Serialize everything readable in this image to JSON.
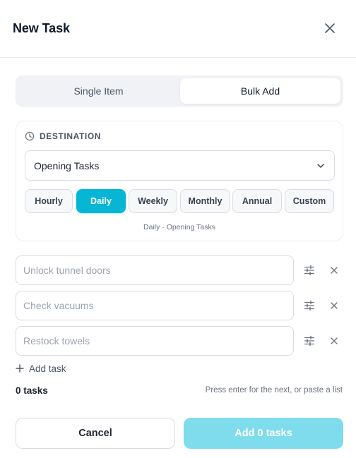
{
  "dialog": {
    "title": "New Task"
  },
  "mode_tabs": [
    {
      "label": "Single Item",
      "selected": false
    },
    {
      "label": "Bulk Add",
      "selected": true
    }
  ],
  "destination": {
    "label": "DESTINATION",
    "selected_list": "Opening Tasks",
    "frequencies": [
      "Hourly",
      "Daily",
      "Weekly",
      "Monthly",
      "Annual",
      "Custom"
    ],
    "active_frequency": "Daily",
    "summary": "Daily · Opening Tasks"
  },
  "tasks": [
    {
      "value": "",
      "placeholder": "Unlock tunnel doors"
    },
    {
      "value": "",
      "placeholder": "Check vacuums"
    },
    {
      "value": "",
      "placeholder": "Restock towels"
    }
  ],
  "add_task_label": "Add task",
  "task_count": "0 tasks",
  "hint": "Press enter for the next, or paste a list",
  "footer": {
    "cancel_label": "Cancel",
    "submit_label": "Add 0 tasks"
  },
  "colors": {
    "accent": "#06b6d4",
    "accent_disabled": "#7fdcec"
  },
  "icons": {
    "close": "close-icon",
    "destination": "clock-icon",
    "select": "chevron-down-icon",
    "task_options": "sliders-icon",
    "task_remove": "close-icon",
    "add": "plus-icon"
  }
}
